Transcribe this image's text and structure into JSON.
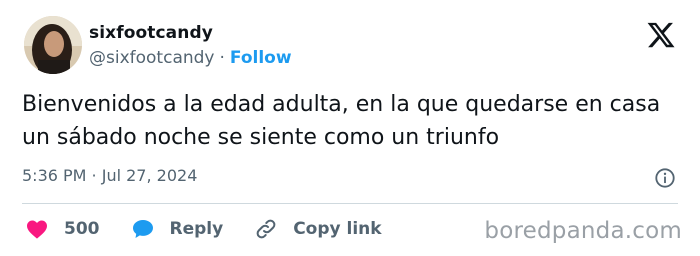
{
  "author": {
    "display_name": "sixfootcandy",
    "handle": "@sixfootcandy",
    "separator": "·",
    "follow_label": "Follow"
  },
  "tweet": {
    "text": "Bienvenidos a la edad adulta, en la que quedarse en casa un sábado noche se siente como un triunfo",
    "timestamp": "5:36 PM · Jul 27, 2024"
  },
  "actions": {
    "likes_count": "500",
    "reply_label": "Reply",
    "copy_link_label": "Copy link"
  },
  "icons": {
    "platform": "x-logo-icon",
    "info": "info-icon",
    "like": "heart-icon",
    "reply": "speech-bubble-icon",
    "copy_link": "link-icon"
  },
  "colors": {
    "text": "#0f1419",
    "muted": "#536471",
    "accent": "#1d9bf0",
    "like": "#f91880",
    "divider": "#cfd9de"
  },
  "watermark": "boredpanda.com"
}
